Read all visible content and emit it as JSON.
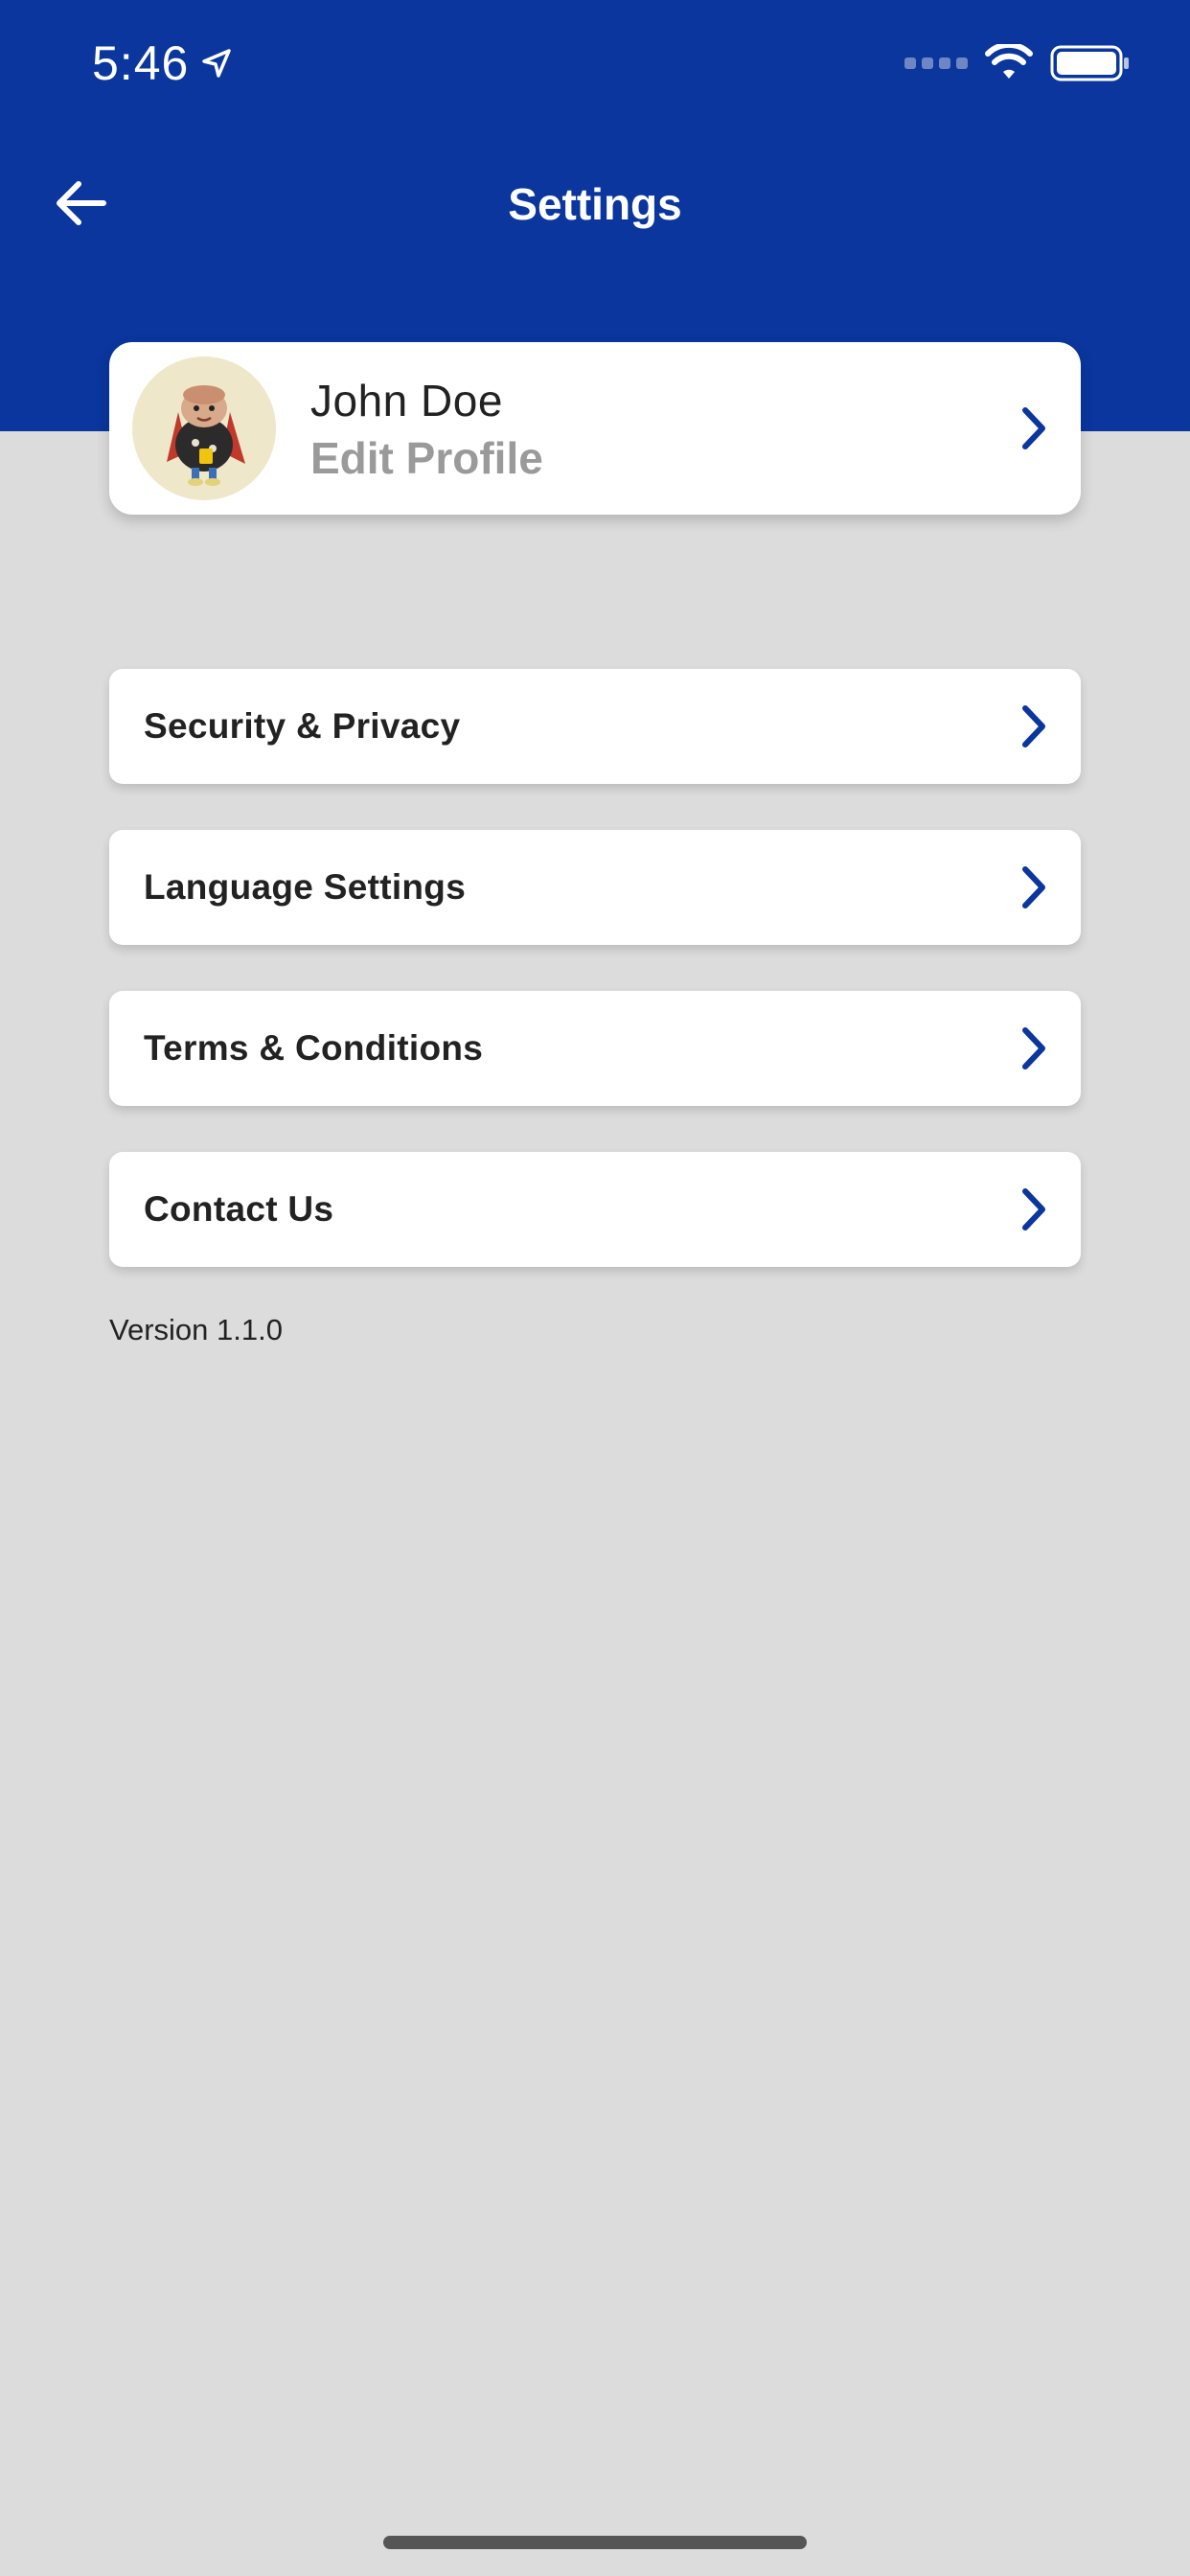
{
  "status_bar": {
    "time": "5:46",
    "location_icon": "location-arrow-icon",
    "wifi_icon": "wifi-icon",
    "battery_icon": "battery-full-icon"
  },
  "nav": {
    "title": "Settings",
    "back_icon": "arrow-left-icon"
  },
  "profile": {
    "name": "John Doe",
    "action": "Edit Profile",
    "avatar_icon": "cartoon-avatar"
  },
  "menu": {
    "items": [
      {
        "label": "Security & Privacy"
      },
      {
        "label": "Language Settings"
      },
      {
        "label": "Terms & Conditions"
      },
      {
        "label": "Contact Us"
      }
    ]
  },
  "footer": {
    "version": "Version 1.1.0"
  },
  "colors": {
    "header": "#0a369d",
    "background": "#dcdcdc",
    "accent": "#0a369d",
    "muted_text": "#9a9a9a"
  }
}
